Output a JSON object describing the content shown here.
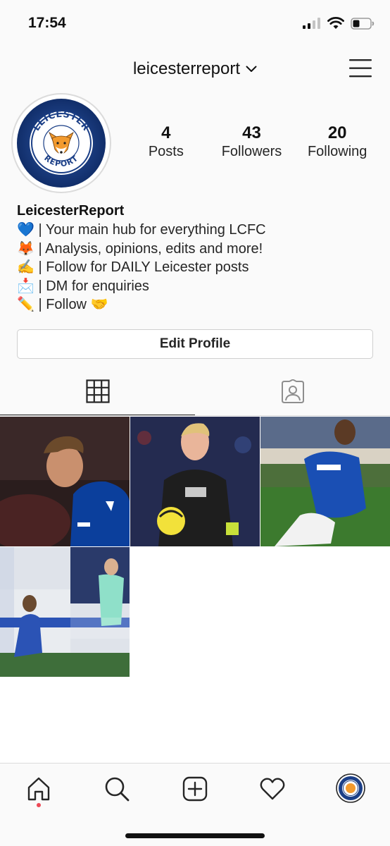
{
  "status_bar": {
    "time": "17:54"
  },
  "header": {
    "username": "leicesterreport",
    "icons": [
      "chevron-down-icon",
      "hamburger-menu-icon"
    ]
  },
  "profile": {
    "avatar_logo": {
      "top_text": "LEICESTER",
      "bottom_text": "REPORT",
      "colors": {
        "ring": "#1b3f87",
        "inner": "#ffffff",
        "fox": "#f29a2e"
      }
    },
    "stats": [
      {
        "value": "4",
        "label": "Posts"
      },
      {
        "value": "43",
        "label": "Followers"
      },
      {
        "value": "20",
        "label": "Following"
      }
    ],
    "name": "LeicesterReport",
    "bio_lines": [
      "💙 | Your main hub for everything LCFC",
      "🦊 | Analysis, opinions, edits and more!",
      "✍️ | Follow for DAILY Leicester posts",
      "📩 | DM for enquiries",
      "✏️ | Follow 🤝"
    ],
    "edit_button": "Edit Profile"
  },
  "tabs": [
    {
      "icon": "grid-icon",
      "active": true
    },
    {
      "icon": "tagged-person-icon",
      "active": false
    }
  ],
  "posts": [
    {
      "description": "Leicester player in blue kit looking down",
      "colors": [
        "#2a1c1c",
        "#0b3f9c"
      ]
    },
    {
      "description": "Goalkeeper in black kit holding yellow ball",
      "colors": [
        "#1d2340",
        "#1e1e1e"
      ]
    },
    {
      "description": "Rangers player in blue kit celebrating on knees",
      "colors": [
        "#4d6f3b",
        "#1a4fb4"
      ]
    },
    {
      "description": "Leicester player kneeling on pitch, goalkeeper in green",
      "colors": [
        "#3e6e3a",
        "#2b53b5"
      ]
    }
  ],
  "bottom_nav": [
    {
      "icon": "home-icon",
      "badge": true
    },
    {
      "icon": "search-icon"
    },
    {
      "icon": "new-post-icon"
    },
    {
      "icon": "activity-heart-icon"
    },
    {
      "icon": "profile-avatar-icon"
    }
  ],
  "colors": {
    "accent_dot": "#ed4956",
    "text": "#262626",
    "divider": "#dbdbdb"
  }
}
